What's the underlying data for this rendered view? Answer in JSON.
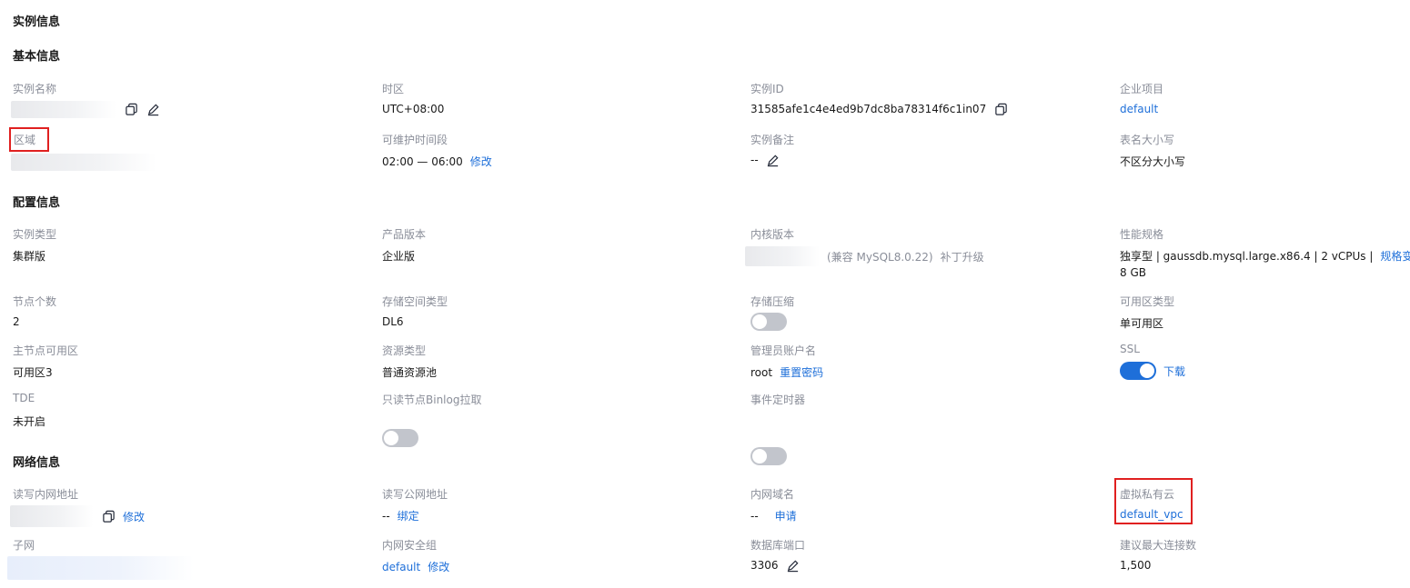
{
  "page_title": "实例信息",
  "basic": {
    "heading": "基本信息",
    "name_label": "实例名称",
    "timezone_label": "时区",
    "timezone_value": "UTC+08:00",
    "instance_id_label": "实例ID",
    "instance_id_value": "31585afe1c4e4ed9b7dc8ba78314f6c1in07",
    "project_label": "企业项目",
    "project_value": "default",
    "region_label": "区域",
    "maint_label": "可维护时间段",
    "maint_value": "02:00 — 06:00",
    "maint_edit": "修改",
    "remark_label": "实例备注",
    "remark_value": "--",
    "case_label": "表名大小写",
    "case_value": "不区分大小写"
  },
  "config": {
    "heading": "配置信息",
    "type_label": "实例类型",
    "type_value": "集群版",
    "edition_label": "产品版本",
    "edition_value": "企业版",
    "kernel_label": "内核版本",
    "kernel_compat": "(兼容 MySQL8.0.22)",
    "kernel_upgrade": "补丁升级",
    "spec_label": "性能规格",
    "spec_value": "独享型 | gaussdb.mysql.large.x86.4 | 2 vCPUs |",
    "spec_change": "规格变更",
    "spec_mem": "8 GB",
    "nodes_label": "节点个数",
    "nodes_value": "2",
    "storage_type_label": "存储空间类型",
    "storage_type_value": "DL6",
    "compress_label": "存储压缩",
    "compress_on": false,
    "az_type_label": "可用区类型",
    "az_type_value": "单可用区",
    "primary_az_label": "主节点可用区",
    "primary_az_value": "可用区3",
    "resource_label": "资源类型",
    "resource_value": "普通资源池",
    "admin_label": "管理员账户名",
    "admin_value": "root",
    "admin_reset": "重置密码",
    "ssl_label": "SSL",
    "ssl_on": true,
    "ssl_download": "下载",
    "tde_label": "TDE",
    "tde_value": "未开启",
    "binlog_label": "只读节点Binlog拉取",
    "binlog_on": false,
    "event_label": "事件定时器",
    "event_on": false
  },
  "network": {
    "heading": "网络信息",
    "rw_addr_label": "读写内网地址",
    "rw_addr_edit": "修改",
    "public_label": "读写公网地址",
    "public_value": "--",
    "public_bind": "绑定",
    "domain_label": "内网域名",
    "domain_value": "--",
    "domain_apply": "申请",
    "vpc_label": "虚拟私有云",
    "vpc_value": "default_vpc",
    "subnet_label": "子网",
    "sg_label": "内网安全组",
    "sg_value": "default",
    "sg_edit": "修改",
    "port_label": "数据库端口",
    "port_value": "3306",
    "maxconn_label": "建议最大连接数",
    "maxconn_value": "1,500"
  },
  "colors": {
    "link": "#1e6fd9",
    "label": "#8a8e99",
    "toggle_on": "#1e6fd9",
    "highlight": "#e02020"
  }
}
